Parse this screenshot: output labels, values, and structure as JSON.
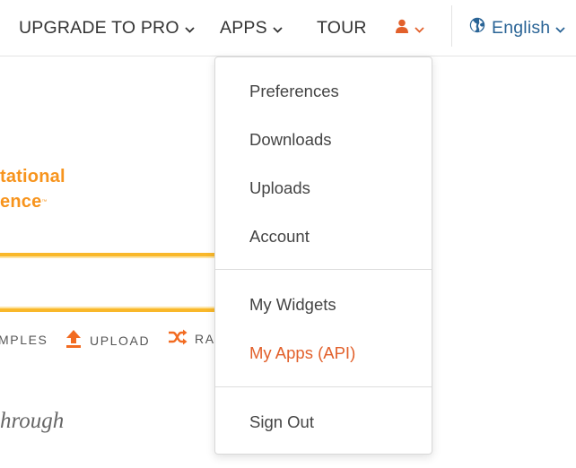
{
  "nav": {
    "upgrade_label": "UPGRADE TO PRO",
    "apps_label": "APPS",
    "tour_label": "TOUR",
    "language_label": "English",
    "user_icon": "user-icon",
    "globe_icon": "globe-icon"
  },
  "background": {
    "title_line1": "tational",
    "title_line2": "ence",
    "trademark": "™",
    "actions": {
      "examples_label": "MPLES",
      "upload_label": "UPLOAD",
      "random_label": "RA"
    },
    "tagline": "hrough"
  },
  "dropdown": {
    "items": [
      {
        "label": "Preferences"
      },
      {
        "label": "Downloads"
      },
      {
        "label": "Uploads"
      },
      {
        "label": "Account"
      },
      {
        "label": "My Widgets"
      },
      {
        "label": "My Apps (API)"
      },
      {
        "label": "Sign Out"
      }
    ]
  },
  "colors": {
    "accent_orange": "#f7941d",
    "active_item": "#e2602b",
    "link_blue": "#2a6496",
    "search_border": "#f9b82a"
  }
}
